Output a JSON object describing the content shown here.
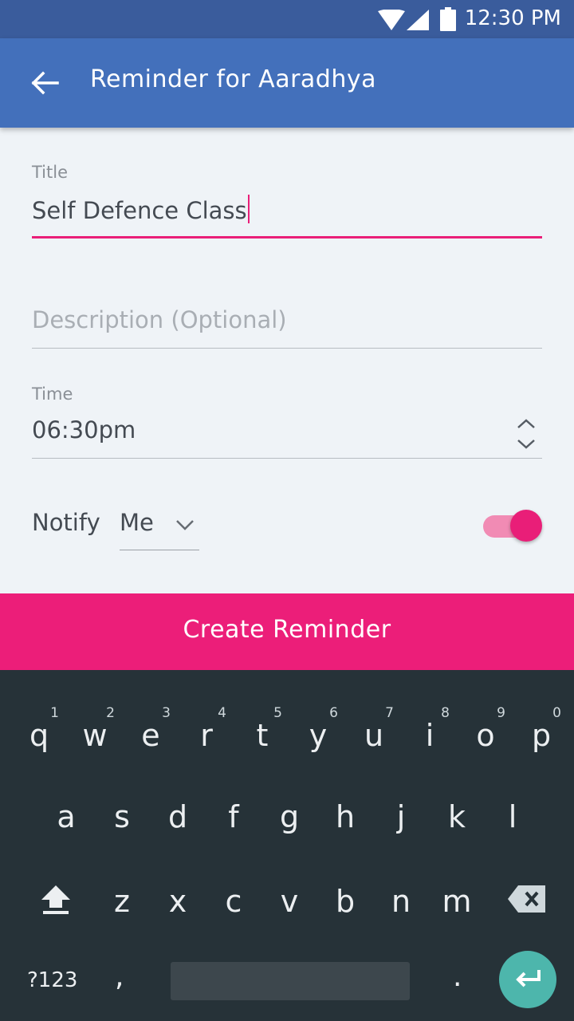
{
  "status": {
    "time": "12:30 PM"
  },
  "appbar": {
    "title": "Reminder for Aaradhya"
  },
  "form": {
    "title_label": "Title",
    "title_value": "Self Defence Class",
    "description_placeholder": "Description (Optional)",
    "time_label": "Time",
    "time_value": "06:30pm",
    "notify_label": "Notify",
    "notify_selected": "Me",
    "notify_enabled": true
  },
  "cta": {
    "label": "Create Reminder"
  },
  "colors": {
    "primary": "#4370bb",
    "status": "#3a5c9c",
    "accent": "#ec1e79",
    "keyboard": "#263238",
    "enter": "#4db6ac"
  },
  "keyboard": {
    "row1": [
      {
        "k": "q",
        "h": "1"
      },
      {
        "k": "w",
        "h": "2"
      },
      {
        "k": "e",
        "h": "3"
      },
      {
        "k": "r",
        "h": "4"
      },
      {
        "k": "t",
        "h": "5"
      },
      {
        "k": "y",
        "h": "6"
      },
      {
        "k": "u",
        "h": "7"
      },
      {
        "k": "i",
        "h": "8"
      },
      {
        "k": "o",
        "h": "9"
      },
      {
        "k": "p",
        "h": "0"
      }
    ],
    "row2": [
      "a",
      "s",
      "d",
      "f",
      "g",
      "h",
      "j",
      "k",
      "l"
    ],
    "row3": [
      "z",
      "x",
      "c",
      "v",
      "b",
      "n",
      "m"
    ],
    "symbols_label": "?123",
    "comma": ",",
    "period": "."
  }
}
